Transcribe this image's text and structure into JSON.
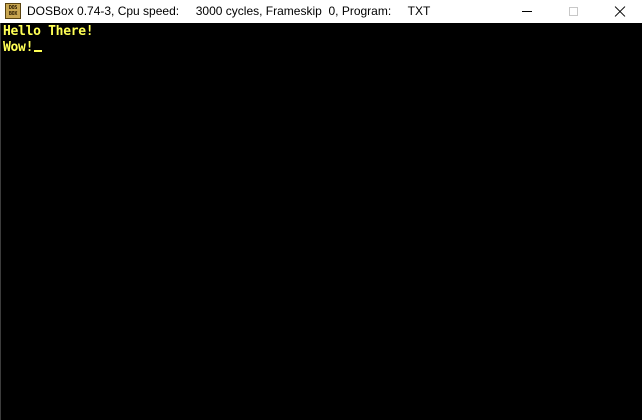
{
  "window": {
    "title": "DOSBox 0.74-3, Cpu speed:     3000 cycles, Frameskip  0, Program:     TXT",
    "icon_top_text": "DOS",
    "icon_bottom_text": "BOX",
    "icon": "dosbox-icon",
    "buttons": {
      "minimize": "minimize-icon",
      "maximize": "maximize-icon",
      "close": "close-icon"
    }
  },
  "terminal": {
    "text_color": "#ffff55",
    "background": "#000000",
    "lines": [
      "Hello There!",
      "Wow!"
    ],
    "cursor": "_"
  }
}
